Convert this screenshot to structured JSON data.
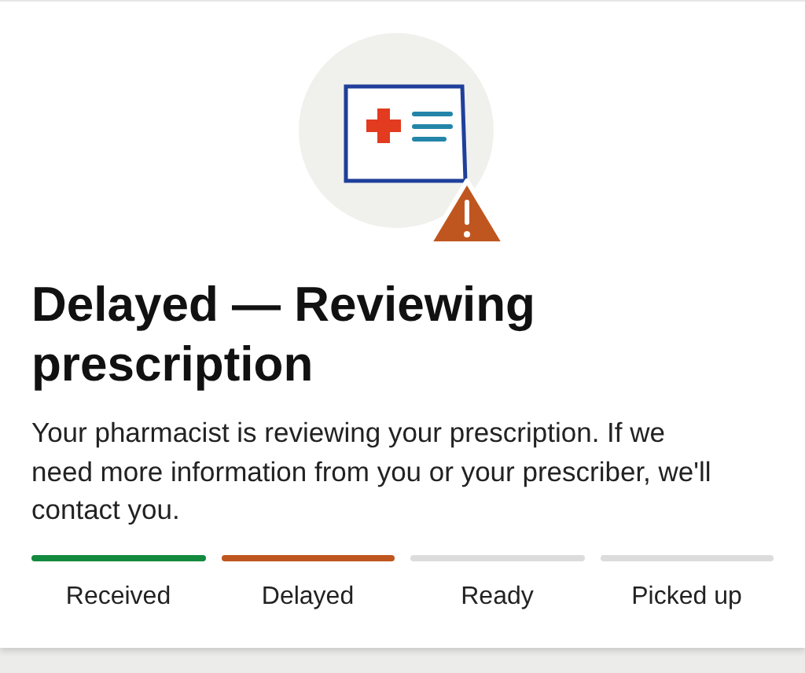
{
  "title": "Delayed — Reviewing prescription",
  "message": "Your pharmacist is reviewing your prescription. If we need more information from you or your prescriber, we'll contact you.",
  "steps": [
    {
      "label": "Received",
      "color": "#138a3e"
    },
    {
      "label": "Delayed",
      "color": "#c0561f"
    },
    {
      "label": "Ready",
      "color": "#dcdcdc"
    },
    {
      "label": "Picked up",
      "color": "#dcdcdc"
    }
  ]
}
